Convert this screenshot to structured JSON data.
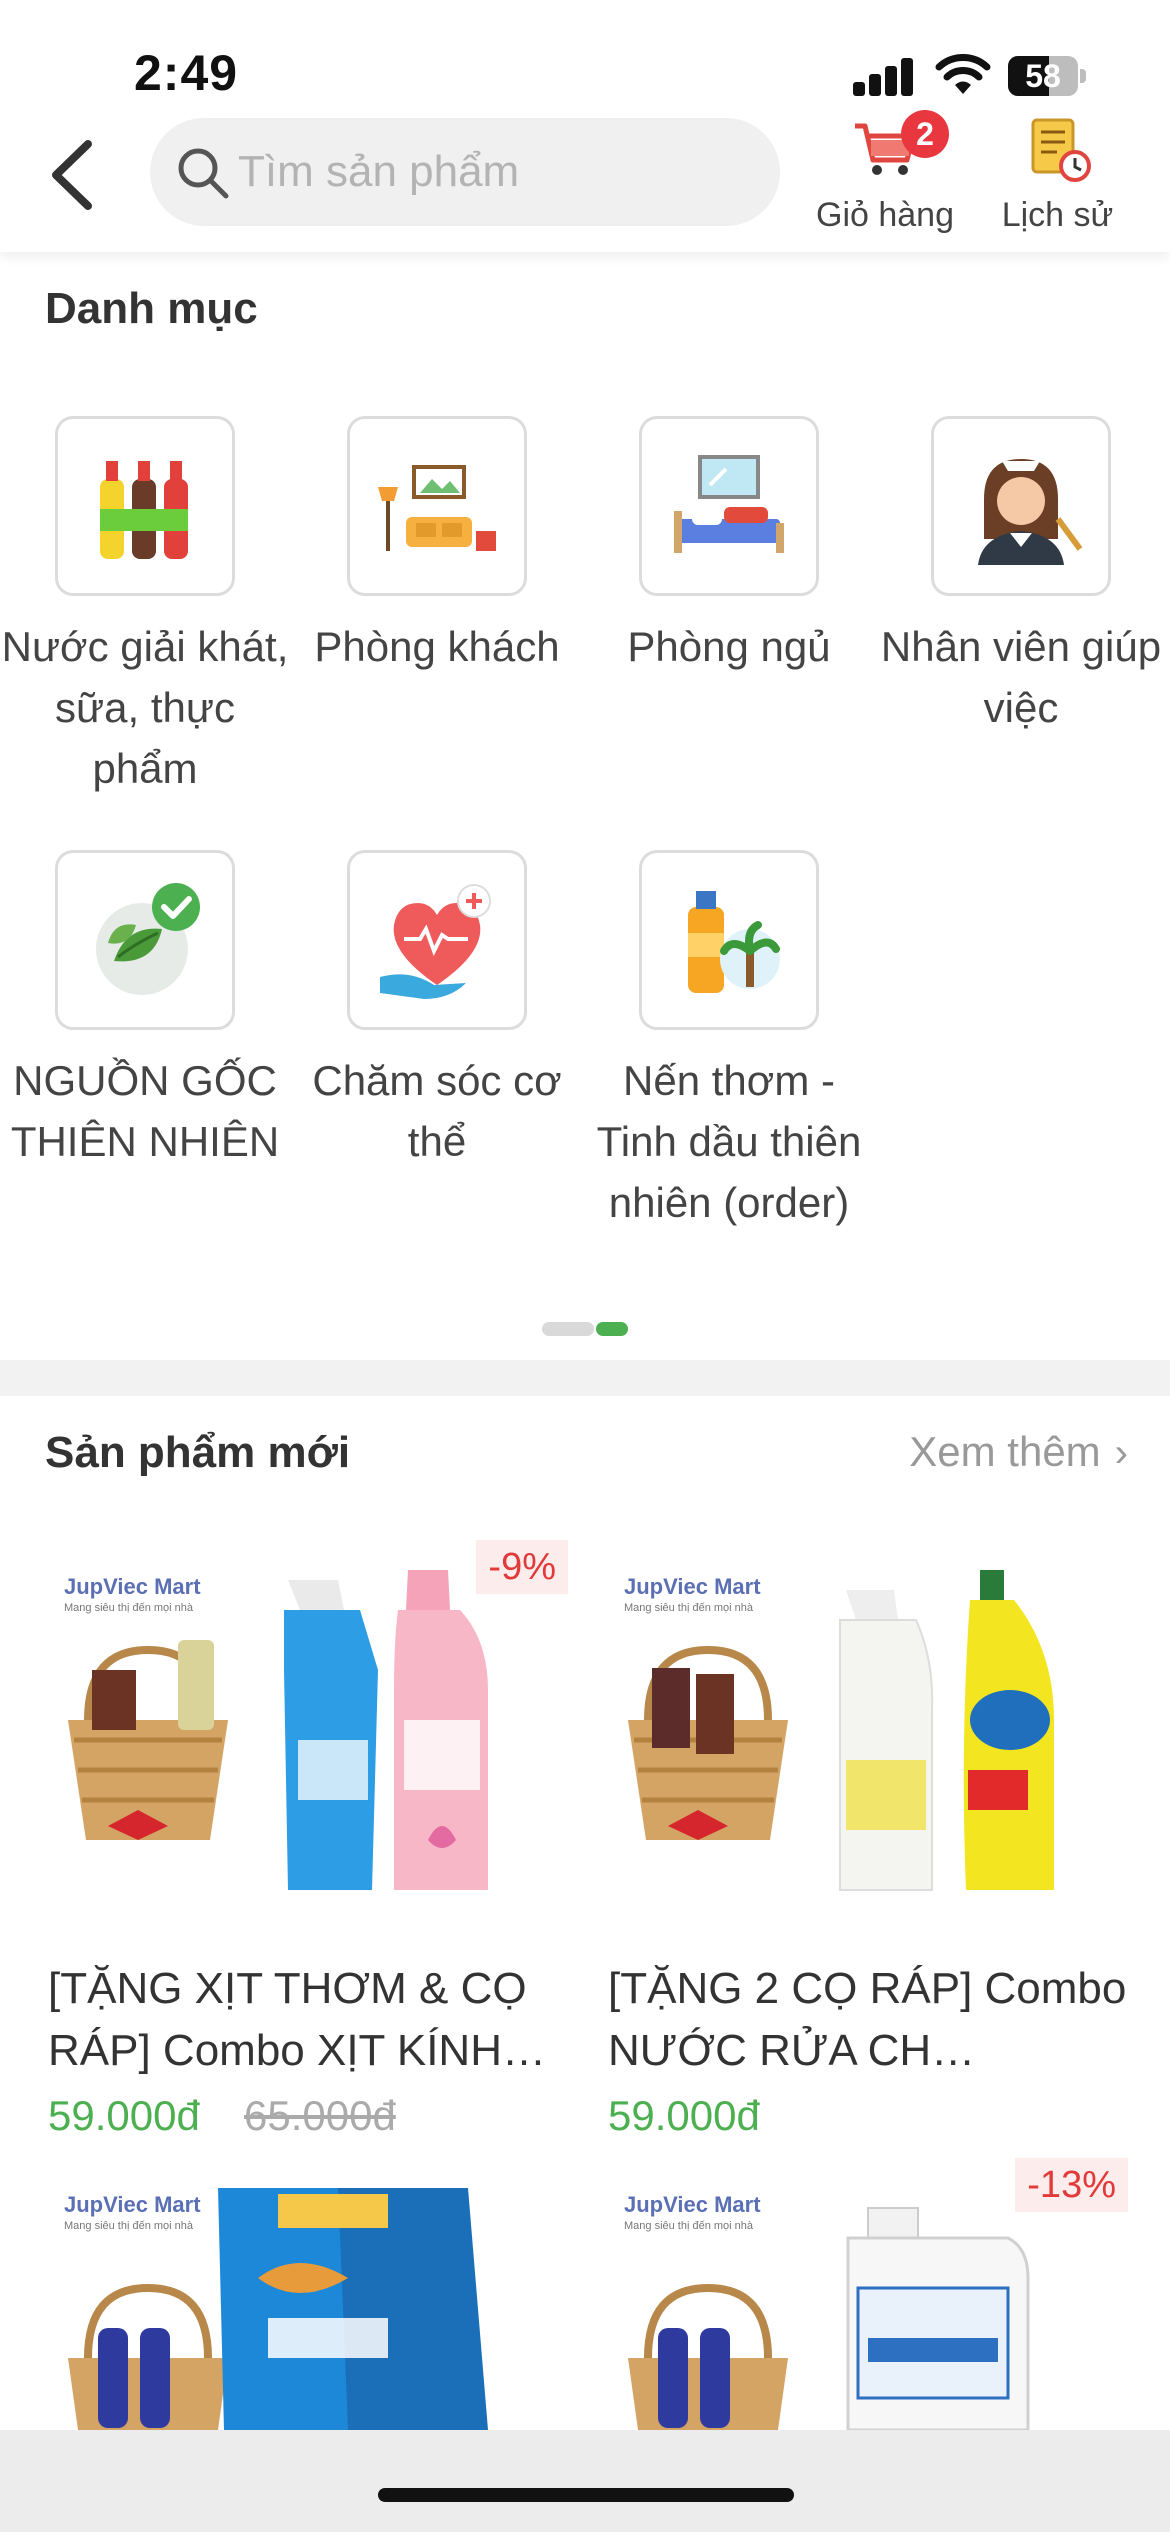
{
  "status_bar": {
    "time": "2:49",
    "battery": "58",
    "battery_level": 0.58
  },
  "header": {
    "search": {
      "placeholder": "Tìm sản phẩm",
      "value": ""
    },
    "cart": {
      "label": "Giỏ hàng",
      "badge": "2"
    },
    "history": {
      "label": "Lịch sử"
    }
  },
  "categories": {
    "title": "Danh mục",
    "items": [
      {
        "label": "Nước giải khát, sữa, thực phẩm",
        "icon": "soft-drinks-icon"
      },
      {
        "label": "Phòng khách",
        "icon": "living-room-icon"
      },
      {
        "label": "Phòng ngủ",
        "icon": "bedroom-icon"
      },
      {
        "label": "Nhân viên giúp việc",
        "icon": "housekeeper-icon"
      },
      {
        "label": "NGUỒN GỐC THIÊN NHIÊN",
        "icon": "natural-leaf-icon"
      },
      {
        "label": "Chăm sóc cơ thể",
        "icon": "body-care-icon"
      },
      {
        "label": "Nến thơm - Tinh dầu thiên nhiên (order)",
        "icon": "essential-oil-icon"
      }
    ],
    "page_indicator": {
      "pages": 2,
      "active": 2
    }
  },
  "new_products": {
    "title": "Sản phẩm mới",
    "see_more": "Xem thêm",
    "items": [
      {
        "title": "[TẶNG XỊT THƠM & CỌ RÁP] Combo XỊT KÍNH…",
        "price": "59.000đ",
        "old_price": "65.000đ",
        "discount": "-9%",
        "brand": "JupViec Mart",
        "brand_tagline": "Mang siêu thị đến mọi nhà"
      },
      {
        "title": "[TẶNG 2 CỌ RÁP] Combo NƯỚC RỬA CH…",
        "price": "59.000đ",
        "old_price": "",
        "discount": "",
        "brand": "JupViec Mart",
        "brand_tagline": "Mang siêu thị đến mọi nhà"
      },
      {
        "title": "",
        "price": "",
        "old_price": "",
        "discount": "",
        "brand": "JupViec Mart",
        "brand_tagline": "Mang siêu thị đến mọi nhà"
      },
      {
        "title": "",
        "price": "",
        "old_price": "",
        "discount": "-13%",
        "brand": "JupViec Mart",
        "brand_tagline": "Mang siêu thị đến mọi nhà"
      }
    ]
  },
  "colors": {
    "accent_green": "#4caf50",
    "badge_red": "#e8373e",
    "discount_red": "#e23a3a"
  }
}
